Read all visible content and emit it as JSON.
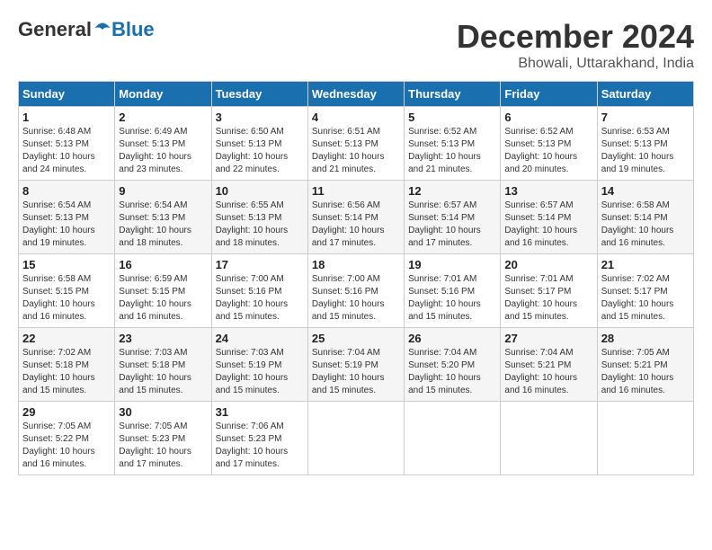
{
  "header": {
    "logo_general": "General",
    "logo_blue": "Blue",
    "month": "December 2024",
    "location": "Bhowali, Uttarakhand, India"
  },
  "days_of_week": [
    "Sunday",
    "Monday",
    "Tuesday",
    "Wednesday",
    "Thursday",
    "Friday",
    "Saturday"
  ],
  "weeks": [
    [
      {
        "day": "1",
        "sunrise": "6:48 AM",
        "sunset": "5:13 PM",
        "daylight": "10 hours and 24 minutes."
      },
      {
        "day": "2",
        "sunrise": "6:49 AM",
        "sunset": "5:13 PM",
        "daylight": "10 hours and 23 minutes."
      },
      {
        "day": "3",
        "sunrise": "6:50 AM",
        "sunset": "5:13 PM",
        "daylight": "10 hours and 22 minutes."
      },
      {
        "day": "4",
        "sunrise": "6:51 AM",
        "sunset": "5:13 PM",
        "daylight": "10 hours and 21 minutes."
      },
      {
        "day": "5",
        "sunrise": "6:52 AM",
        "sunset": "5:13 PM",
        "daylight": "10 hours and 21 minutes."
      },
      {
        "day": "6",
        "sunrise": "6:52 AM",
        "sunset": "5:13 PM",
        "daylight": "10 hours and 20 minutes."
      },
      {
        "day": "7",
        "sunrise": "6:53 AM",
        "sunset": "5:13 PM",
        "daylight": "10 hours and 19 minutes."
      }
    ],
    [
      {
        "day": "8",
        "sunrise": "6:54 AM",
        "sunset": "5:13 PM",
        "daylight": "10 hours and 19 minutes."
      },
      {
        "day": "9",
        "sunrise": "6:54 AM",
        "sunset": "5:13 PM",
        "daylight": "10 hours and 18 minutes."
      },
      {
        "day": "10",
        "sunrise": "6:55 AM",
        "sunset": "5:13 PM",
        "daylight": "10 hours and 18 minutes."
      },
      {
        "day": "11",
        "sunrise": "6:56 AM",
        "sunset": "5:14 PM",
        "daylight": "10 hours and 17 minutes."
      },
      {
        "day": "12",
        "sunrise": "6:57 AM",
        "sunset": "5:14 PM",
        "daylight": "10 hours and 17 minutes."
      },
      {
        "day": "13",
        "sunrise": "6:57 AM",
        "sunset": "5:14 PM",
        "daylight": "10 hours and 16 minutes."
      },
      {
        "day": "14",
        "sunrise": "6:58 AM",
        "sunset": "5:14 PM",
        "daylight": "10 hours and 16 minutes."
      }
    ],
    [
      {
        "day": "15",
        "sunrise": "6:58 AM",
        "sunset": "5:15 PM",
        "daylight": "10 hours and 16 minutes."
      },
      {
        "day": "16",
        "sunrise": "6:59 AM",
        "sunset": "5:15 PM",
        "daylight": "10 hours and 16 minutes."
      },
      {
        "day": "17",
        "sunrise": "7:00 AM",
        "sunset": "5:16 PM",
        "daylight": "10 hours and 15 minutes."
      },
      {
        "day": "18",
        "sunrise": "7:00 AM",
        "sunset": "5:16 PM",
        "daylight": "10 hours and 15 minutes."
      },
      {
        "day": "19",
        "sunrise": "7:01 AM",
        "sunset": "5:16 PM",
        "daylight": "10 hours and 15 minutes."
      },
      {
        "day": "20",
        "sunrise": "7:01 AM",
        "sunset": "5:17 PM",
        "daylight": "10 hours and 15 minutes."
      },
      {
        "day": "21",
        "sunrise": "7:02 AM",
        "sunset": "5:17 PM",
        "daylight": "10 hours and 15 minutes."
      }
    ],
    [
      {
        "day": "22",
        "sunrise": "7:02 AM",
        "sunset": "5:18 PM",
        "daylight": "10 hours and 15 minutes."
      },
      {
        "day": "23",
        "sunrise": "7:03 AM",
        "sunset": "5:18 PM",
        "daylight": "10 hours and 15 minutes."
      },
      {
        "day": "24",
        "sunrise": "7:03 AM",
        "sunset": "5:19 PM",
        "daylight": "10 hours and 15 minutes."
      },
      {
        "day": "25",
        "sunrise": "7:04 AM",
        "sunset": "5:19 PM",
        "daylight": "10 hours and 15 minutes."
      },
      {
        "day": "26",
        "sunrise": "7:04 AM",
        "sunset": "5:20 PM",
        "daylight": "10 hours and 15 minutes."
      },
      {
        "day": "27",
        "sunrise": "7:04 AM",
        "sunset": "5:21 PM",
        "daylight": "10 hours and 16 minutes."
      },
      {
        "day": "28",
        "sunrise": "7:05 AM",
        "sunset": "5:21 PM",
        "daylight": "10 hours and 16 minutes."
      }
    ],
    [
      {
        "day": "29",
        "sunrise": "7:05 AM",
        "sunset": "5:22 PM",
        "daylight": "10 hours and 16 minutes."
      },
      {
        "day": "30",
        "sunrise": "7:05 AM",
        "sunset": "5:23 PM",
        "daylight": "10 hours and 17 minutes."
      },
      {
        "day": "31",
        "sunrise": "7:06 AM",
        "sunset": "5:23 PM",
        "daylight": "10 hours and 17 minutes."
      },
      null,
      null,
      null,
      null
    ]
  ]
}
